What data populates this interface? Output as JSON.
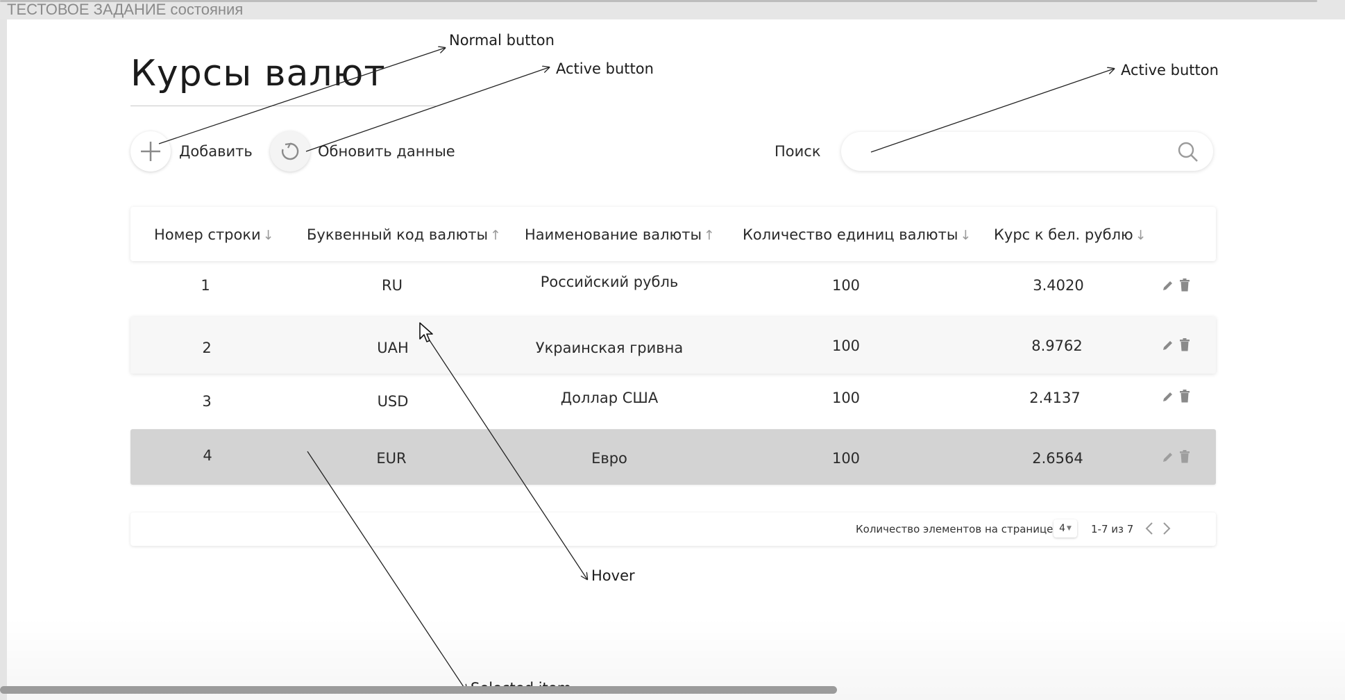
{
  "frame": {
    "title": "ТЕСТОВОЕ ЗАДАНИЕ состояния"
  },
  "page": {
    "title": "Курсы валют"
  },
  "toolbar": {
    "add_label": "Добавить",
    "refresh_label": "Обновить данные",
    "search_label": "Поиск",
    "search_value": ""
  },
  "table": {
    "columns": [
      {
        "label": "Номер строки",
        "sort": "↓"
      },
      {
        "label": "Буквенный код валюты",
        "sort": "↑"
      },
      {
        "label": "Наименование валюты",
        "sort": "↑"
      },
      {
        "label": "Количество единиц валюты",
        "sort": "↓"
      },
      {
        "label": "Курс к бел. рублю",
        "sort": "↓"
      }
    ],
    "rows": [
      {
        "num": "1",
        "code": "RU",
        "name": "Российский рубль",
        "units": "100",
        "rate": "3.4020",
        "state": "normal"
      },
      {
        "num": "2",
        "code": "UAH",
        "name": "Украинская гривна",
        "units": "100",
        "rate": "8.9762",
        "state": "hover"
      },
      {
        "num": "3",
        "code": "USD",
        "name": "Доллар США",
        "units": "100",
        "rate": "2.4137",
        "state": "normal"
      },
      {
        "num": "4",
        "code": "EUR",
        "name": "Евро",
        "units": "100",
        "rate": "2.6564",
        "state": "selected"
      }
    ]
  },
  "pagination": {
    "items_per_page_label": "Количество элементов на странице:",
    "page_size": "4",
    "range": "1-7 из 7"
  },
  "annotations": {
    "normal_button": "Normal button",
    "active_button_refresh": "Active button",
    "active_button_search": "Active button",
    "hover": "Hover",
    "selected_item": "Selected item"
  },
  "colors": {
    "page_background": "#ffffff",
    "hover_row": "#f7f7f7",
    "selected_row": "#d3d3d3",
    "icon_gray": "#8a8a8a"
  },
  "icons": [
    "plus-icon",
    "refresh-icon",
    "search-icon",
    "sort-arrow-icon",
    "pencil-icon",
    "trash-icon",
    "chevron-left-icon",
    "chevron-right-icon",
    "caret-down-icon",
    "mouse-cursor-icon"
  ]
}
